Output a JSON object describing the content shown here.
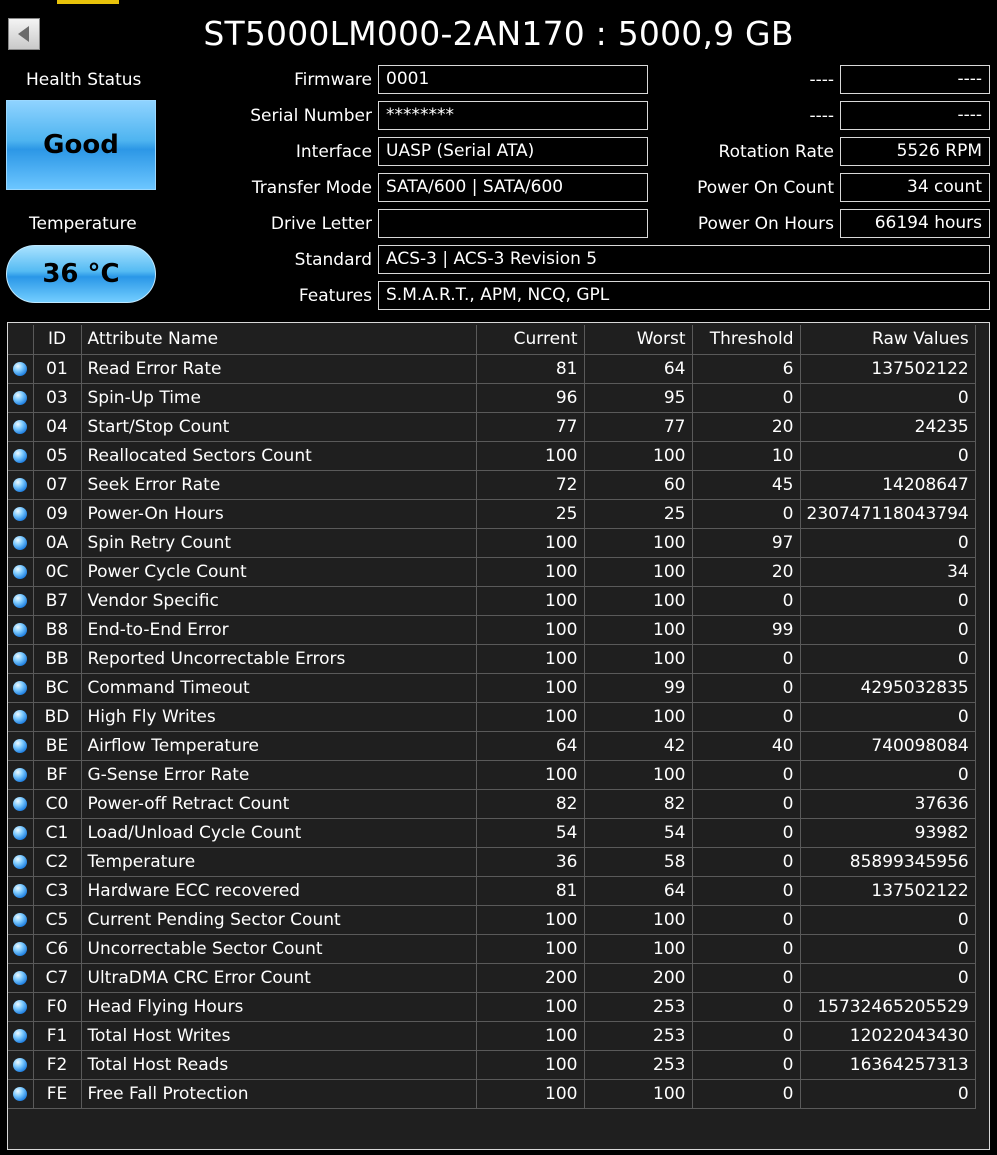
{
  "title": "ST5000LM000-2AN170 : 5000,9 GB",
  "health": {
    "label": "Health Status",
    "value": "Good"
  },
  "temperature": {
    "label": "Temperature",
    "value": "36 °C"
  },
  "fields": {
    "firmware": {
      "label": "Firmware",
      "value": "0001"
    },
    "serial": {
      "label": "Serial Number",
      "value": "********"
    },
    "interface": {
      "label": "Interface",
      "value": "UASP (Serial ATA)"
    },
    "transfer_mode": {
      "label": "Transfer Mode",
      "value": "SATA/600 | SATA/600"
    },
    "drive_letter": {
      "label": "Drive Letter",
      "value": ""
    },
    "standard": {
      "label": "Standard",
      "value": "ACS-3 | ACS-3 Revision 5"
    },
    "features": {
      "label": "Features",
      "value": "S.M.A.R.T., APM, NCQ, GPL"
    },
    "right1": {
      "label": "----",
      "value": "----"
    },
    "right2": {
      "label": "----",
      "value": "----"
    },
    "rotation": {
      "label": "Rotation Rate",
      "value": "5526 RPM"
    },
    "power_count": {
      "label": "Power On Count",
      "value": "34 count"
    },
    "power_hours": {
      "label": "Power On Hours",
      "value": "66194 hours"
    }
  },
  "table": {
    "headers": [
      "ID",
      "Attribute Name",
      "Current",
      "Worst",
      "Threshold",
      "Raw Values"
    ],
    "rows": [
      [
        "01",
        "Read Error Rate",
        "81",
        "64",
        "6",
        "137502122"
      ],
      [
        "03",
        "Spin-Up Time",
        "96",
        "95",
        "0",
        "0"
      ],
      [
        "04",
        "Start/Stop Count",
        "77",
        "77",
        "20",
        "24235"
      ],
      [
        "05",
        "Reallocated Sectors Count",
        "100",
        "100",
        "10",
        "0"
      ],
      [
        "07",
        "Seek Error Rate",
        "72",
        "60",
        "45",
        "14208647"
      ],
      [
        "09",
        "Power-On Hours",
        "25",
        "25",
        "0",
        "230747118043794"
      ],
      [
        "0A",
        "Spin Retry Count",
        "100",
        "100",
        "97",
        "0"
      ],
      [
        "0C",
        "Power Cycle Count",
        "100",
        "100",
        "20",
        "34"
      ],
      [
        "B7",
        "Vendor Specific",
        "100",
        "100",
        "0",
        "0"
      ],
      [
        "B8",
        "End-to-End Error",
        "100",
        "100",
        "99",
        "0"
      ],
      [
        "BB",
        "Reported Uncorrectable Errors",
        "100",
        "100",
        "0",
        "0"
      ],
      [
        "BC",
        "Command Timeout",
        "100",
        "99",
        "0",
        "4295032835"
      ],
      [
        "BD",
        "High Fly Writes",
        "100",
        "100",
        "0",
        "0"
      ],
      [
        "BE",
        "Airflow Temperature",
        "64",
        "42",
        "40",
        "740098084"
      ],
      [
        "BF",
        "G-Sense Error Rate",
        "100",
        "100",
        "0",
        "0"
      ],
      [
        "C0",
        "Power-off Retract Count",
        "82",
        "82",
        "0",
        "37636"
      ],
      [
        "C1",
        "Load/Unload Cycle Count",
        "54",
        "54",
        "0",
        "93982"
      ],
      [
        "C2",
        "Temperature",
        "36",
        "58",
        "0",
        "85899345956"
      ],
      [
        "C3",
        "Hardware ECC recovered",
        "81",
        "64",
        "0",
        "137502122"
      ],
      [
        "C5",
        "Current Pending Sector Count",
        "100",
        "100",
        "0",
        "0"
      ],
      [
        "C6",
        "Uncorrectable Sector Count",
        "100",
        "100",
        "0",
        "0"
      ],
      [
        "C7",
        "UltraDMA CRC Error Count",
        "200",
        "200",
        "0",
        "0"
      ],
      [
        "F0",
        "Head Flying Hours",
        "100",
        "253",
        "0",
        "15732465205529"
      ],
      [
        "F1",
        "Total Host Writes",
        "100",
        "253",
        "0",
        "12022043430"
      ],
      [
        "F2",
        "Total Host Reads",
        "100",
        "253",
        "0",
        "16364257313"
      ],
      [
        "FE",
        "Free Fall Protection",
        "100",
        "100",
        "0",
        "0"
      ]
    ]
  },
  "colors": {
    "accent": "#e8c20a",
    "good": "#3aa7ee",
    "background": "#000000",
    "table_bg": "#1f1f1f"
  },
  "icons": {
    "back": "back-arrow-icon",
    "status": "status-ball-icon"
  }
}
